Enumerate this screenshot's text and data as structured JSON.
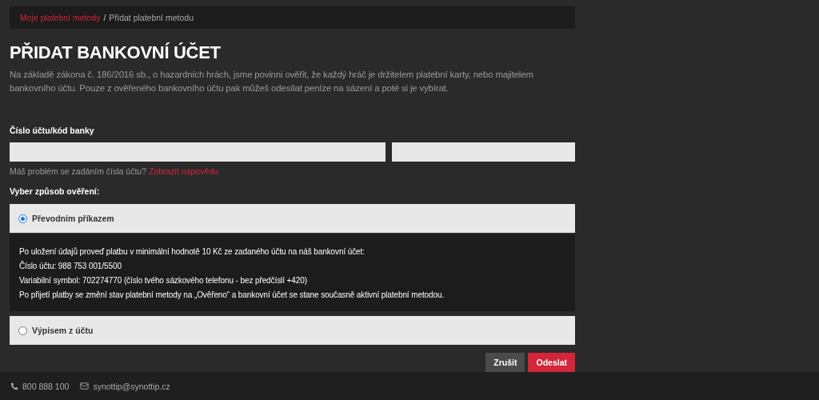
{
  "breadcrumb": [
    {
      "label": "Moje platební metody",
      "kind": "link"
    },
    {
      "label": "Přidat platební metodu",
      "kind": "current"
    }
  ],
  "breadcrumb_separator": "/",
  "title": "PŘIDAT BANKOVNÍ ÚČET",
  "intro": "Na základě zákona č. 186/2016 sb., o hazardních hrách, jsme povinni ověřit, že každý hráč je držitelem platební karty, nebo majitelem bankovního účtu. Pouze z ověřeného bankovního účtu pak můžeš odesílat peníze na sázení a poté si je vybírat.",
  "account_label": "Číslo účtu/kód banky",
  "help_text": "Máš problém se zadáním čísla účtu?",
  "help_link": "Zobrazit nápovědu",
  "method_label": "Vyber způsob ověření:",
  "methods": [
    {
      "label": "Převodním příkazem",
      "selected": true,
      "details": [
        "Po uložení údajů proveď platbu v minimální hodnotě 10 Kč ze zadaného účtu na náš bankovní účet:",
        "Číslo účtu: 988 753 001/5500",
        "Variabilní symbol: 702274770 (číslo tvého sázkového telefonu - bez předčíslí +420)",
        "Po přijetí platby se změní stav platební metody na „Ověřeno“ a bankovní účet se stane současně aktivní platební metodou."
      ]
    },
    {
      "label": "Výpisem z účtu",
      "selected": false
    }
  ],
  "buttons": [
    {
      "label": "Zrušit",
      "kind": "secondary"
    },
    {
      "label": "Odeslat",
      "kind": "primary"
    }
  ],
  "footer": {
    "phone": "800 888 100",
    "email": "synottip@synottip.cz"
  }
}
